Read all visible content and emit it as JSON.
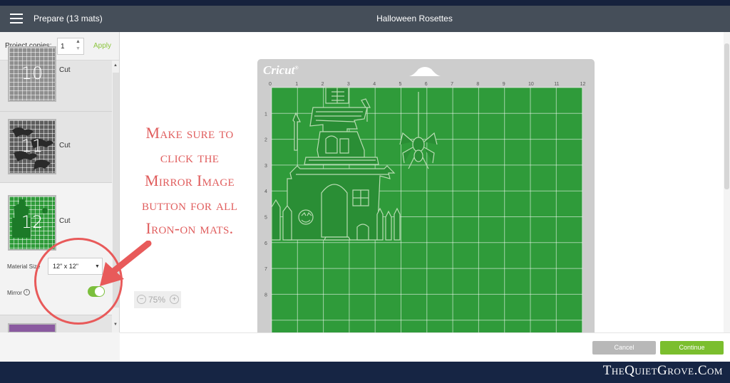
{
  "header": {
    "prepare_title": "Prepare (13 mats)",
    "document_title": "Halloween Rosettes"
  },
  "sidebar": {
    "project_copies_label": "Project copies:",
    "project_copies_value": "1",
    "apply_label": "Apply",
    "mats": [
      {
        "number": "10",
        "action": "Cut",
        "color": "gray"
      },
      {
        "number": "11",
        "action": "Cut",
        "color": "gray"
      },
      {
        "number": "12",
        "action": "Cut",
        "color": "green"
      }
    ],
    "material_size_label": "Material Size",
    "material_size_value": "12\" x 12\"",
    "mirror_label": "Mirror",
    "mirror_on": true
  },
  "canvas": {
    "zoom_minus": "−",
    "zoom_level": "75%",
    "zoom_plus": "+",
    "mat_brand": "Cricut",
    "mat_brand_mark": "®",
    "ruler_top": [
      "0",
      "1",
      "2",
      "3",
      "4",
      "5",
      "6",
      "7",
      "8",
      "9",
      "10",
      "11",
      "12"
    ],
    "ruler_left": [
      "1",
      "2",
      "3",
      "4",
      "5",
      "6",
      "7",
      "8"
    ],
    "mat_color": "#2f9b3a"
  },
  "footer": {
    "cancel_label": "Cancel",
    "continue_label": "Continue"
  },
  "annotation": {
    "lines": [
      "Make sure to",
      "click the",
      "Mirror Image",
      "button for all",
      "Iron-on mats."
    ],
    "color": "#e05d5d"
  },
  "watermark": "TheQuietGrove.Com"
}
